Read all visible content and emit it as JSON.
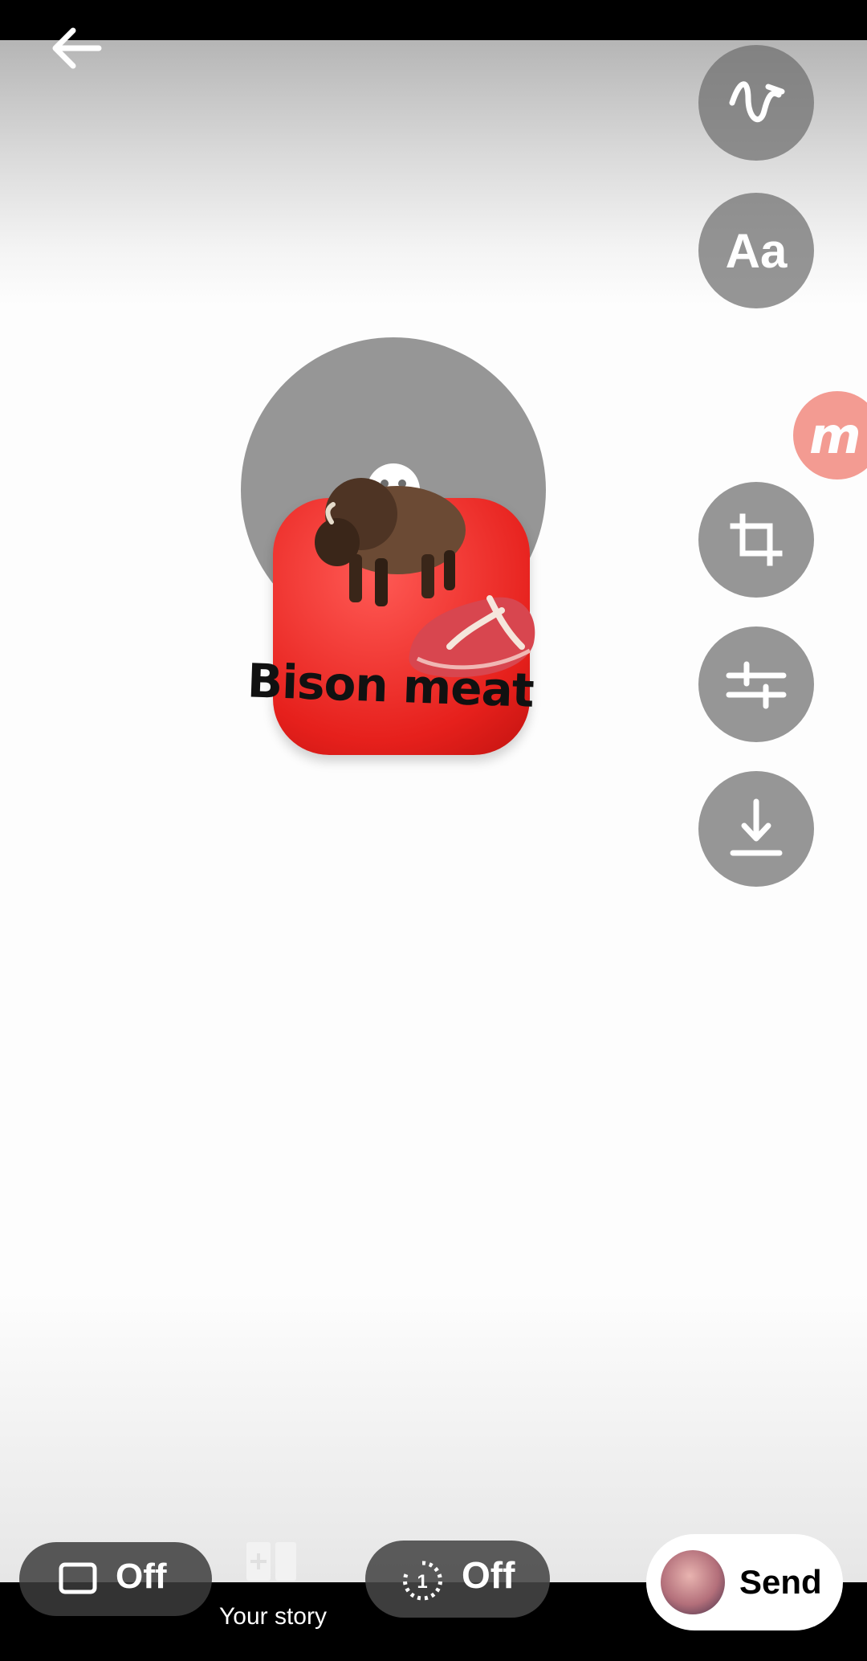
{
  "editor": {
    "tools": [
      {
        "name": "draw",
        "icon": "squiggle-draw-icon"
      },
      {
        "name": "text",
        "icon": "text-aa-icon",
        "label": "Aa"
      },
      {
        "name": "sticker",
        "icon": "smiley-sticker-icon"
      },
      {
        "name": "crop",
        "icon": "crop-icon"
      },
      {
        "name": "adjust",
        "icon": "sliders-adjust-icon"
      },
      {
        "name": "download",
        "icon": "download-icon"
      }
    ],
    "overlay_badge": {
      "letter": "m",
      "color": "#f28a80"
    }
  },
  "sticker": {
    "label": "Bison meat",
    "tile_color": "#e6201c"
  },
  "bottom": {
    "hd_toggle": {
      "state": "Off"
    },
    "your_story": {
      "label": "Your story"
    },
    "timer": {
      "value": "1",
      "state": "Off"
    },
    "send": {
      "label": "Send"
    }
  }
}
